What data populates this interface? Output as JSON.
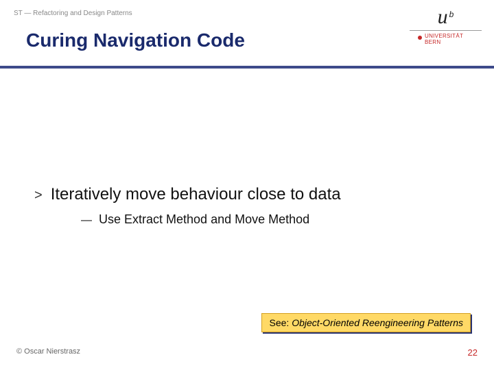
{
  "header": {
    "breadcrumb": "ST — Refactoring and Design Patterns",
    "title": "Curing Navigation Code"
  },
  "logo": {
    "letters": {
      "u": "u",
      "b": "b"
    },
    "university_line1": "UNIVERSITÄT",
    "university_line2": "BERN"
  },
  "content": {
    "main_bullet": ">",
    "main_text": "Iteratively move behaviour close to data",
    "sub_bullet": "—",
    "sub_text": "Use Extract Method and Move Method"
  },
  "reference": {
    "prefix": "See: ",
    "title": "Object-Oriented Reengineering Patterns"
  },
  "footer": {
    "copyright": "© Oscar Nierstrasz",
    "page": "22"
  }
}
